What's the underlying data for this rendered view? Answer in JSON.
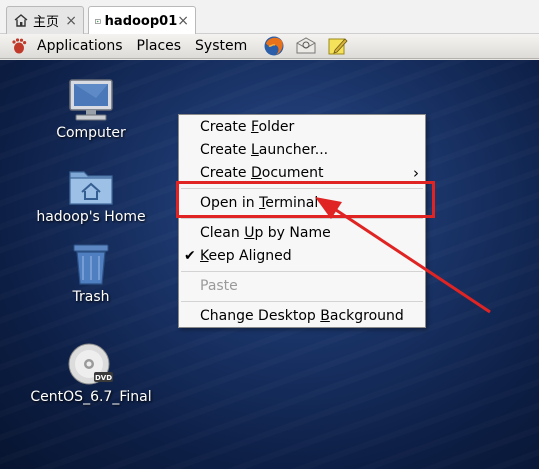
{
  "tabs": {
    "home_label": "主页",
    "vm_label": "hadoop01",
    "close_glyph": "×"
  },
  "panel": {
    "menus": [
      "Applications",
      "Places",
      "System"
    ],
    "launchers": [
      "firefox-icon",
      "mail-icon",
      "notes-icon"
    ]
  },
  "desktop_icons": [
    {
      "label": "Computer",
      "icon": "computer-icon"
    },
    {
      "label": "hadoop's Home",
      "icon": "home-folder-icon"
    },
    {
      "label": "Trash",
      "icon": "trash-icon"
    },
    {
      "label": "CentOS_6.7_Final",
      "icon": "dvd-icon"
    }
  ],
  "context_menu": {
    "items": [
      {
        "pre": "Create ",
        "u": "F",
        "post": "older",
        "state": "normal"
      },
      {
        "pre": "Create ",
        "u": "L",
        "post": "auncher...",
        "state": "normal"
      },
      {
        "pre": "Create ",
        "u": "D",
        "post": "ocument",
        "state": "submenu"
      },
      {
        "pre": "Open in ",
        "u": "T",
        "post": "erminal",
        "state": "normal"
      },
      {
        "pre": "Clean ",
        "u": "U",
        "post": "p by Name",
        "state": "normal"
      },
      {
        "pre": "",
        "u": "K",
        "post": "eep Aligned",
        "state": "checked"
      },
      {
        "pre": "Paste",
        "u": "",
        "post": "",
        "state": "disabled"
      },
      {
        "pre": "Change Desktop ",
        "u": "B",
        "post": "ackground",
        "state": "normal"
      }
    ],
    "submenu_glyph": "›",
    "check_glyph": "✔"
  },
  "annotation": {
    "highlight_color": "#e02424",
    "highlighted_item": "Open in Terminal"
  }
}
